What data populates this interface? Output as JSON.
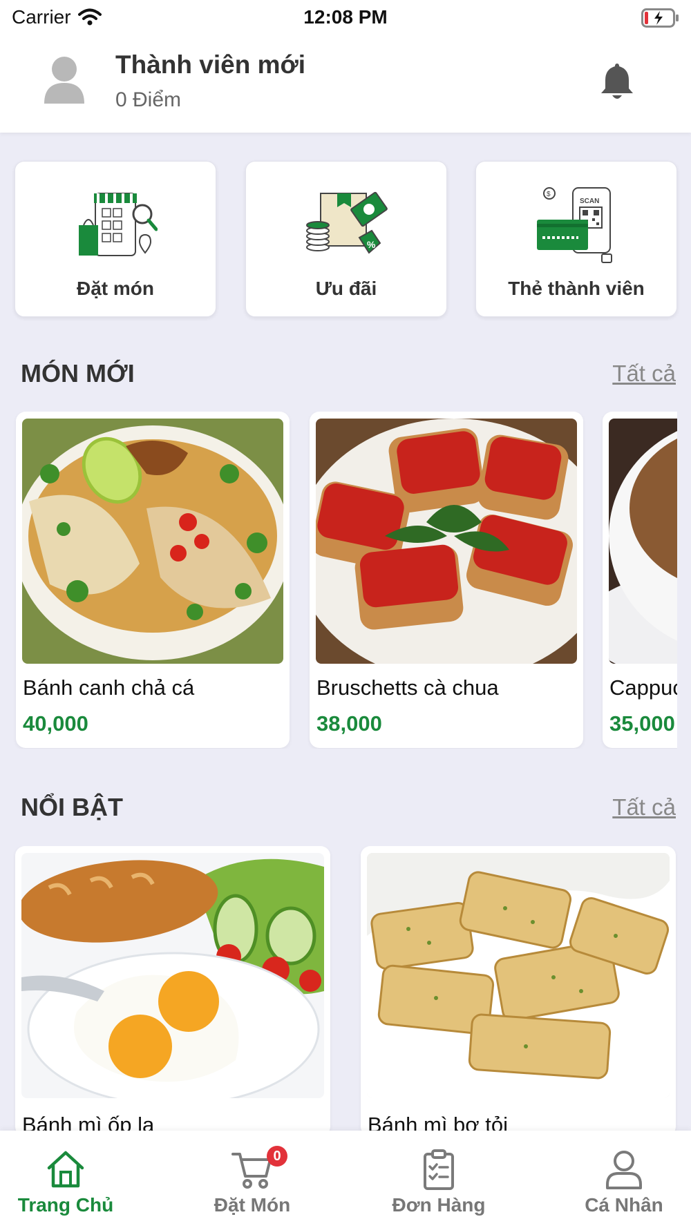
{
  "status_bar": {
    "carrier": "Carrier",
    "time": "12:08 PM"
  },
  "header": {
    "member_name": "Thành viên mới",
    "points": "0 Điểm"
  },
  "actions": [
    {
      "label": "Đặt món",
      "icon": "shop-icon"
    },
    {
      "label": "Ưu đãi",
      "icon": "deal-icon"
    },
    {
      "label": "Thẻ thành viên",
      "icon": "member-card-icon"
    }
  ],
  "new_items": {
    "title": "MÓN MỚI",
    "see_all": "Tất cả",
    "items": [
      {
        "name": "Bánh canh chả cá",
        "price": "40,000"
      },
      {
        "name": "Bruschetts cà chua",
        "price": "38,000"
      },
      {
        "name": "Cappuccino",
        "price": "35,000"
      }
    ]
  },
  "featured": {
    "title": "NỔI BẬT",
    "see_all": "Tất cả",
    "items": [
      {
        "name": "Bánh mì ốp la"
      },
      {
        "name": "Bánh mì bơ tỏi"
      }
    ]
  },
  "tabbar": {
    "tabs": [
      {
        "label": "Trang Chủ",
        "icon": "home-icon",
        "active": true
      },
      {
        "label": "Đặt Món",
        "icon": "cart-icon",
        "badge": "0"
      },
      {
        "label": "Đơn Hàng",
        "icon": "clipboard-icon"
      },
      {
        "label": "Cá Nhân",
        "icon": "user-icon"
      }
    ]
  },
  "colors": {
    "accent": "#1a8a3c",
    "background": "#ececf6",
    "badge": "#e2323a"
  }
}
